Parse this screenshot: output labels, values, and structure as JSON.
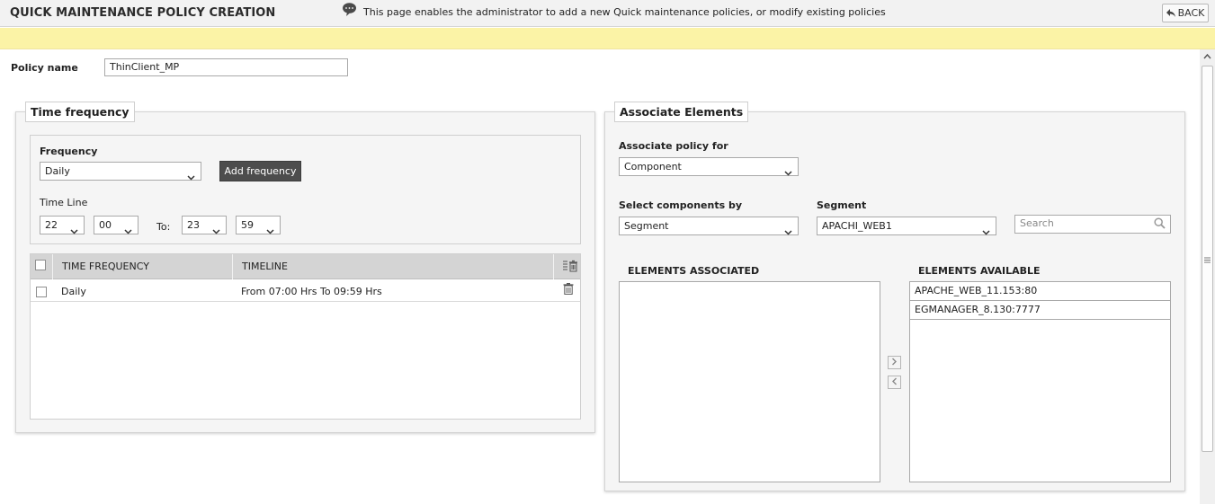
{
  "header": {
    "title": "QUICK MAINTENANCE POLICY CREATION",
    "back_label": "BACK"
  },
  "banner": {
    "text": "This page enables the administrator to add a new Quick maintenance policies, or modify existing policies"
  },
  "policy": {
    "label": "Policy name",
    "value": "ThinClient_MP"
  },
  "time_frequency": {
    "legend": "Time frequency",
    "frequency_label": "Frequency",
    "frequency_value": "Daily",
    "add_button": "Add frequency",
    "timeline_label": "Time Line",
    "from_hour": "22",
    "from_minute": "00",
    "to_label": "To:",
    "to_hour": "23",
    "to_minute": "59",
    "table": {
      "columns": [
        "TIME FREQUENCY",
        "TIMELINE"
      ],
      "rows": [
        {
          "frequency": "Daily",
          "timeline": "From 07:00 Hrs To 09:59 Hrs"
        }
      ]
    }
  },
  "associate": {
    "legend": "Associate Elements",
    "policy_for_label": "Associate policy for",
    "policy_for_value": "Component",
    "select_by_label": "Select components by",
    "select_by_value": "Segment",
    "segment_label": "Segment",
    "segment_value": "APACHI_WEB1",
    "search_placeholder": "Search",
    "associated_header": "ELEMENTS ASSOCIATED",
    "available_header": "ELEMENTS AVAILABLE",
    "available_items": [
      "APACHE_WEB_11.153:80",
      "EGMANAGER_8.130:7777"
    ],
    "associated_items": []
  },
  "colors": {
    "banner_bg": "#fbf3a6",
    "dark_button": "#4d4d4d",
    "table_header": "#d4d4d4"
  }
}
